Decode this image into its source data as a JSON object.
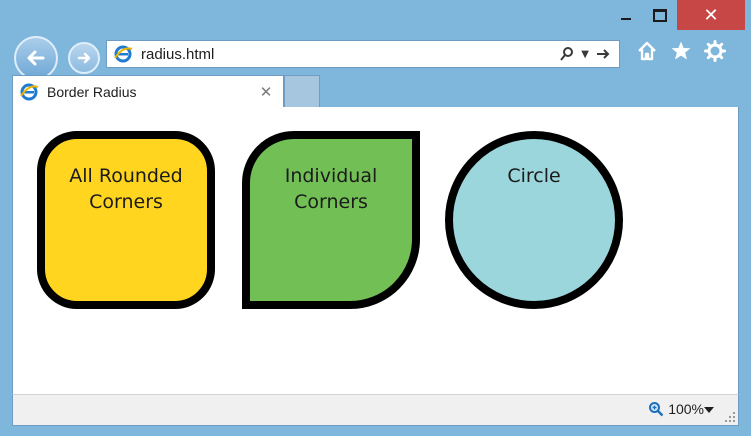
{
  "browser": {
    "address": {
      "url": "radius.html"
    },
    "tab": {
      "title": "Border Radius"
    },
    "status": {
      "zoom": "100%"
    },
    "icons": [
      "back-arrow-icon",
      "forward-arrow-icon",
      "ie-logo-icon",
      "search-icon",
      "dropdown-arrow-icon",
      "go-arrow-icon",
      "home-icon",
      "favorites-star-icon",
      "settings-gear-icon",
      "close-icon",
      "zoom-icon",
      "resize-grip-icon"
    ]
  },
  "page": {
    "boxes": [
      {
        "label": "All Rounded Corners",
        "color": "#ffd51f"
      },
      {
        "label": "Individual Corners",
        "color": "#72c055"
      },
      {
        "label": "Circle",
        "color": "#9bd6dc"
      }
    ]
  },
  "colors": {
    "frame": "#7fb6dc",
    "close_button": "#c74646"
  }
}
